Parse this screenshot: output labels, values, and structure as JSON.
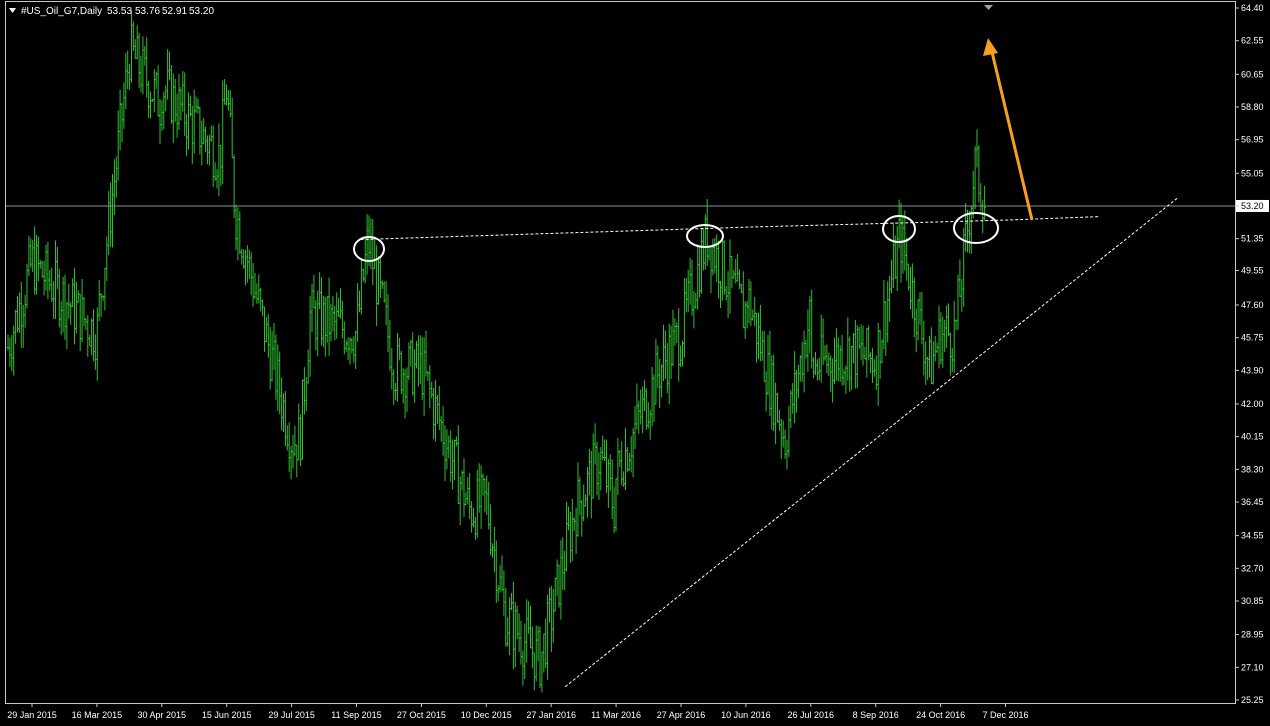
{
  "header": {
    "menu_icon": "triangle-down-icon",
    "symbol": "#US_Oil_G7,Daily",
    "open": "53.53",
    "high": "53.76",
    "low": "52.91",
    "close": "53.20"
  },
  "colors": {
    "background": "#000000",
    "frame": "#c8c8c8",
    "bars": "#2fbf2f",
    "price_line": "#8a8f99",
    "price_label_bg": "#ffffff",
    "price_label_text": "#000000",
    "annotation": "#ffffff",
    "arrow": "#f5a023",
    "marker": "#9aa3ad"
  },
  "chart_data": {
    "type": "ohlc_bars",
    "timeframe": "Daily",
    "ylim": [
      25.25,
      64.4
    ],
    "ylabels": [
      "64.40",
      "62.55",
      "60.65",
      "58.80",
      "56.95",
      "55.05",
      "53.20",
      "51.35",
      "49.55",
      "47.60",
      "45.75",
      "43.90",
      "42.00",
      "40.15",
      "38.30",
      "36.45",
      "34.55",
      "32.70",
      "30.85",
      "28.95",
      "27.10",
      "25.25"
    ],
    "current_price": "53.20",
    "xlabels": [
      "29 Jan 2015",
      "16 Mar 2015",
      "30 Apr 2015",
      "15 Jun 2015",
      "29 Jul 2015",
      "11 Sep 2015",
      "27 Oct 2015",
      "10 Dec 2015",
      "27 Jan 2016",
      "11 Mar 2016",
      "27 Apr 2016",
      "10 Jun 2016",
      "26 Jul 2016",
      "8 Sep 2016",
      "24 Oct 2016",
      "7 Dec 2016"
    ],
    "series": [
      {
        "x": [
          "29 Jan 2015",
          "16 Mar 2015",
          "30 Apr 2015",
          "15 Jun 2015",
          "29 Jul 2015",
          "11 Sep 2015",
          "27 Oct 2015",
          "10 Dec 2015",
          "27 Jan 2016",
          "11 Mar 2016",
          "27 Apr 2016",
          "10 Jun 2016",
          "26 Jul 2016",
          "8 Sep 2016",
          "24 Oct 2016",
          "7 Dec 2016"
        ],
        "close": [
          50.0,
          46.0,
          60.0,
          60.0,
          40.0,
          46.0,
          44.0,
          36.5,
          30.0,
          38.0,
          46.0,
          48.5,
          44.0,
          44.5,
          46.0,
          53.2
        ]
      }
    ],
    "annotations": {
      "neckline": [
        [
          "11 Sep 2015",
          51.3
        ],
        [
          "10 Jun 2016",
          52.0
        ],
        [
          "7 Dec 2016",
          52.4
        ]
      ],
      "trendline": [
        [
          "27 Jan 2016",
          26.0
        ],
        [
          "24 Oct 2016",
          43.9
        ]
      ],
      "circled_highs": [
        "11 Sep 2015",
        "10 Jun 2016",
        "24 Oct 2016",
        "7 Dec 2016"
      ],
      "arrow": "up"
    }
  }
}
